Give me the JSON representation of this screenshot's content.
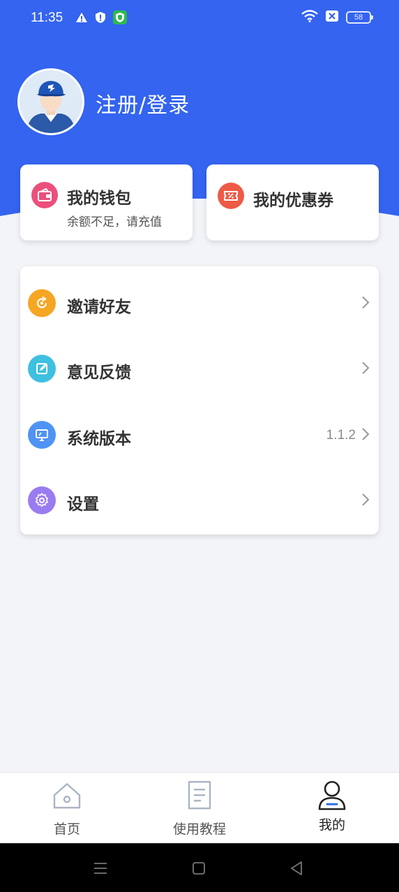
{
  "status_bar": {
    "time": "11:35",
    "battery": "58",
    "left_icons": [
      "warning-icon",
      "shield-alert-icon",
      "vpn-shield-icon"
    ],
    "right_icons": [
      "wifi-icon",
      "sim-off-icon",
      "battery-icon"
    ]
  },
  "profile": {
    "login_label": "注册/登录"
  },
  "wallet": {
    "title": "我的钱包",
    "subtitle": "余额不足，请充值",
    "icon": "wallet-icon",
    "icon_color": "#ec4f7c"
  },
  "coupon": {
    "title": "我的优惠券",
    "icon": "ticket-icon",
    "icon_color": "#ee5a46"
  },
  "menu": {
    "items": [
      {
        "label": "邀请好友",
        "icon": "refresh-icon",
        "color": "#f5a623",
        "value": ""
      },
      {
        "label": "意见反馈",
        "icon": "edit-icon",
        "color": "#3ec0e0",
        "value": ""
      },
      {
        "label": "系统版本",
        "icon": "monitor-icon",
        "color": "#4f93f5",
        "value": "1.1.2"
      },
      {
        "label": "设置",
        "icon": "gear-icon",
        "color": "#9b7cf0",
        "value": ""
      }
    ]
  },
  "tab_bar": {
    "tabs": [
      {
        "label": "首页",
        "icon": "home-icon",
        "active": false
      },
      {
        "label": "使用教程",
        "icon": "document-icon",
        "active": false
      },
      {
        "label": "我的",
        "icon": "user-icon",
        "active": true
      }
    ]
  },
  "colors": {
    "header_blue": "#3464f0",
    "background": "#f3f4f8",
    "active_tab": "#2b6de8"
  }
}
